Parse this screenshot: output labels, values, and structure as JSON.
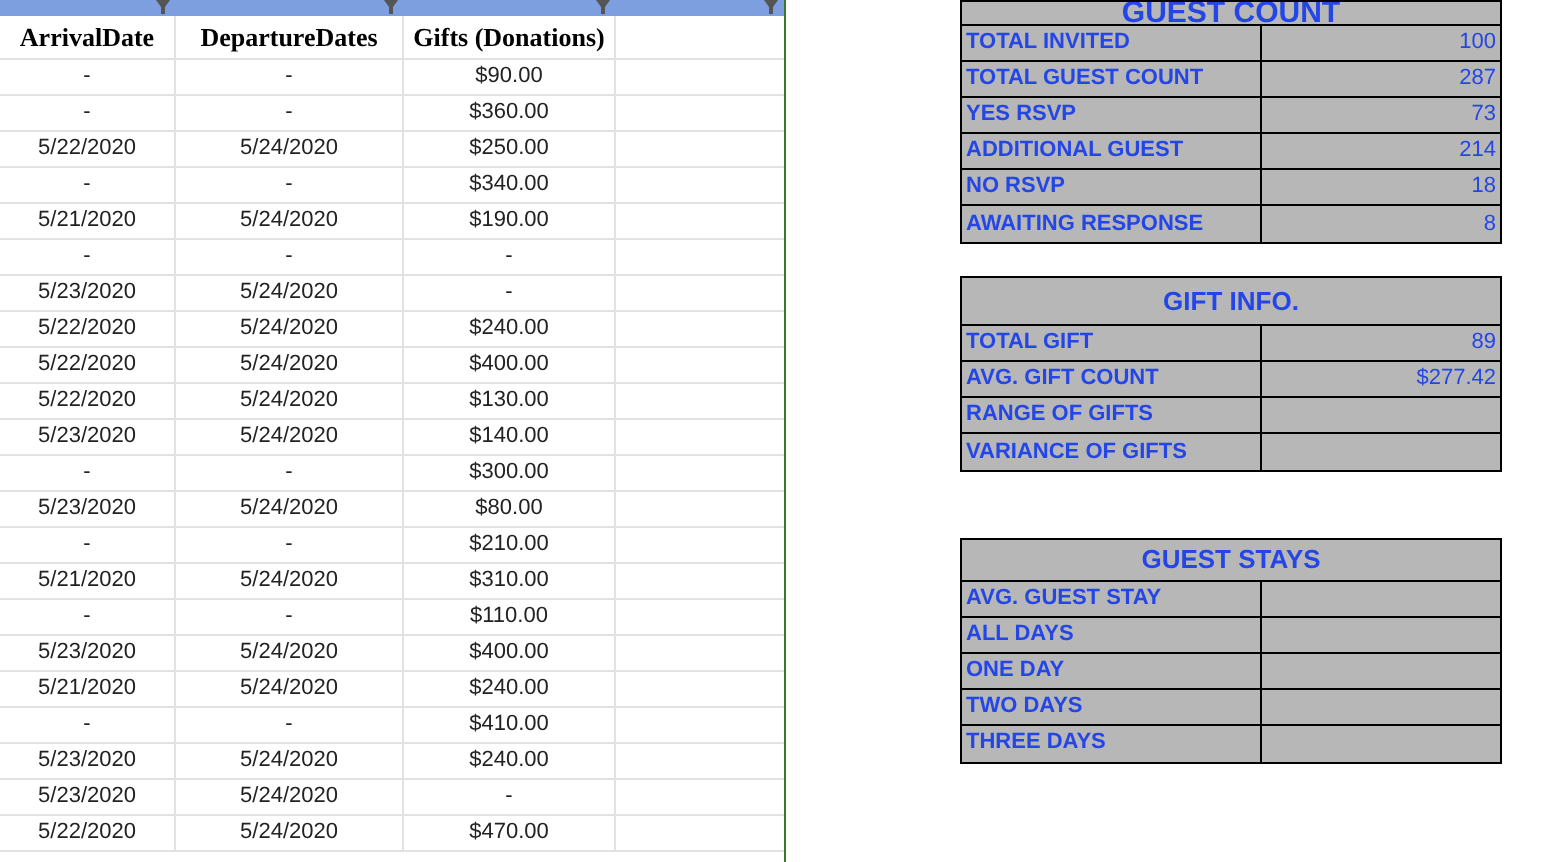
{
  "columns": [
    "ArrivalDate",
    "DepartureDates",
    "Gifts (Donations)"
  ],
  "rows": [
    [
      "-",
      "-",
      "$90.00"
    ],
    [
      "-",
      "-",
      "$360.00"
    ],
    [
      "5/22/2020",
      "5/24/2020",
      "$250.00"
    ],
    [
      "-",
      "-",
      "$340.00"
    ],
    [
      "5/21/2020",
      "5/24/2020",
      "$190.00"
    ],
    [
      "-",
      "-",
      "-"
    ],
    [
      "5/23/2020",
      "5/24/2020",
      "-"
    ],
    [
      "5/22/2020",
      "5/24/2020",
      "$240.00"
    ],
    [
      "5/22/2020",
      "5/24/2020",
      "$400.00"
    ],
    [
      "5/22/2020",
      "5/24/2020",
      "$130.00"
    ],
    [
      "5/23/2020",
      "5/24/2020",
      "$140.00"
    ],
    [
      "-",
      "-",
      "$300.00"
    ],
    [
      "5/23/2020",
      "5/24/2020",
      "$80.00"
    ],
    [
      "-",
      "-",
      "$210.00"
    ],
    [
      "5/21/2020",
      "5/24/2020",
      "$310.00"
    ],
    [
      "-",
      "-",
      "$110.00"
    ],
    [
      "5/23/2020",
      "5/24/2020",
      "$400.00"
    ],
    [
      "5/21/2020",
      "5/24/2020",
      "$240.00"
    ],
    [
      "-",
      "-",
      "$410.00"
    ],
    [
      "5/23/2020",
      "5/24/2020",
      "$240.00"
    ],
    [
      "5/23/2020",
      "5/24/2020",
      "-"
    ],
    [
      "5/22/2020",
      "5/24/2020",
      "$470.00"
    ]
  ],
  "guest_count": {
    "title": "GUEST COUNT",
    "rows": [
      {
        "label": "TOTAL INVITED",
        "value": "100"
      },
      {
        "label": "TOTAL GUEST COUNT",
        "value": "287"
      },
      {
        "label": "YES RSVP",
        "value": "73"
      },
      {
        "label": "ADDITIONAL GUEST",
        "value": "214"
      },
      {
        "label": "NO RSVP",
        "value": "18"
      },
      {
        "label": "AWAITING RESPONSE",
        "value": "8"
      }
    ]
  },
  "gift_info": {
    "title": "GIFT INFO.",
    "rows": [
      {
        "label": "TOTAL GIFT",
        "value": "89"
      },
      {
        "label": "AVG. GIFT COUNT",
        "value": "$277.42"
      },
      {
        "label": "RANGE OF GIFTS"
      },
      {
        "label": "VARIANCE OF GIFTS"
      }
    ]
  },
  "guest_stays": {
    "title": "GUEST STAYS",
    "rows": [
      {
        "label": "AVG. GUEST STAY"
      },
      {
        "label": "ALL DAYS"
      },
      {
        "label": "ONE DAY"
      },
      {
        "label": "TWO DAYS"
      },
      {
        "label": "THREE DAYS"
      }
    ]
  }
}
